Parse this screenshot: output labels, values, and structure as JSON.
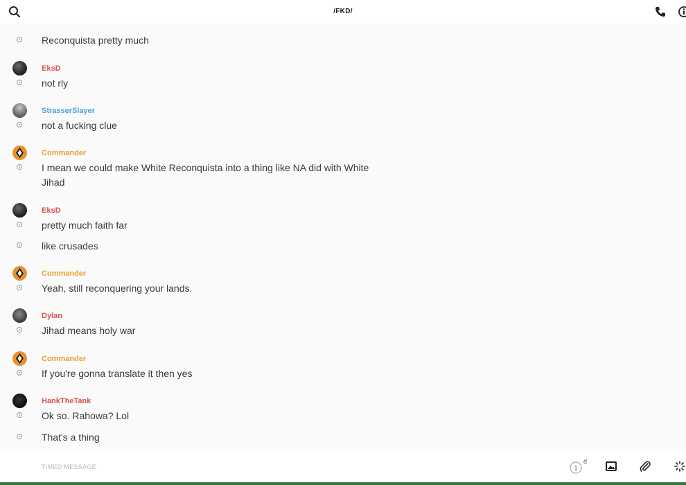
{
  "header": {
    "title": "/FKD/"
  },
  "composer": {
    "placeholder": "TIMED MESSAGE",
    "timer_value": "1",
    "timer_unit": "d"
  },
  "colors": {
    "red_user": "#d9534f",
    "blue_user": "#4aa3d8",
    "orange_user": "#e8a030",
    "bottom_bar": "#2f7d3a"
  },
  "messages": [
    {
      "user": "",
      "lines": [
        "Reconquista pretty much"
      ]
    },
    {
      "user": "EksD",
      "lines": [
        "not rly"
      ]
    },
    {
      "user": "StrasserSlayer",
      "lines": [
        "not a fucking clue"
      ]
    },
    {
      "user": "Commander",
      "lines": [
        "I mean we could make White Reconquista into a thing like NA did with White Jihad"
      ]
    },
    {
      "user": "EksD",
      "lines": [
        "pretty much faith far",
        "like crusades"
      ]
    },
    {
      "user": "Commander",
      "lines": [
        "Yeah, still reconquering your lands."
      ]
    },
    {
      "user": "Dylan",
      "lines": [
        "Jihad means holy war"
      ]
    },
    {
      "user": "Commander",
      "lines": [
        "If you're gonna translate it then yes"
      ]
    },
    {
      "user": "HankTheTank",
      "lines": [
        "Ok so. Rahowa? Lol",
        "That's a thing"
      ]
    }
  ]
}
